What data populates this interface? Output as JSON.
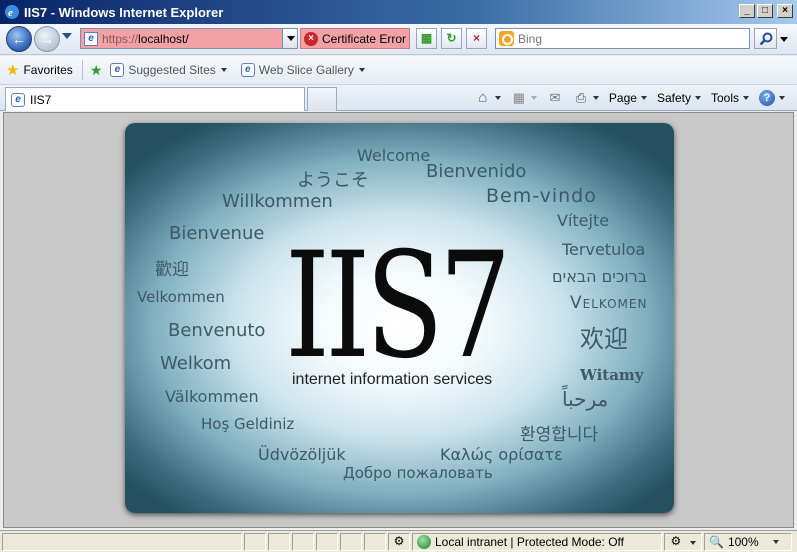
{
  "window": {
    "title": "IIS7 - Windows Internet Explorer"
  },
  "address": {
    "url_prefix": "https://",
    "url_host": "localhost/",
    "cert_error": "Certificate Error"
  },
  "search": {
    "placeholder": "Bing"
  },
  "favorites": {
    "label": "Favorites",
    "suggested": "Suggested Sites",
    "webslice": "Web Slice Gallery"
  },
  "tab": {
    "title": "IIS7"
  },
  "commands": {
    "page": "Page",
    "safety": "Safety",
    "tools": "Tools"
  },
  "banner": {
    "logo": "IIS7",
    "subtitle": "internet information services",
    "greetings": {
      "welcome": "Welcome",
      "youkoso": "ようこそ",
      "bienvenido": "Bienvenido",
      "bemvindo": "Bem-vindo",
      "willkommen": "Willkommen",
      "bienvenue": "Bienvenue",
      "vitejte": "Vítejte",
      "tervetuloa": "Tervetuloa",
      "huanying_trad": "歡迎",
      "hebrew": "ברוכים הבאים",
      "velkommen": "Velkommen",
      "velkomen": "Velkomen",
      "huanying": "欢迎",
      "benvenuto": "Benvenuto",
      "welkom": "Welkom",
      "witamy": "Witamy",
      "valkommen": "Välkommen",
      "marhaban": "مرحباً",
      "hosgeldiniz": "Hoş Geldiniz",
      "korean": "환영합니다",
      "udvozoljuk": "Üdvözöljük",
      "greek": "Καλώς ορίσατε",
      "russian": "Добро пожаловать"
    }
  },
  "status": {
    "zone": "Local intranet | Protected Mode: Off",
    "zoom": "100%"
  }
}
